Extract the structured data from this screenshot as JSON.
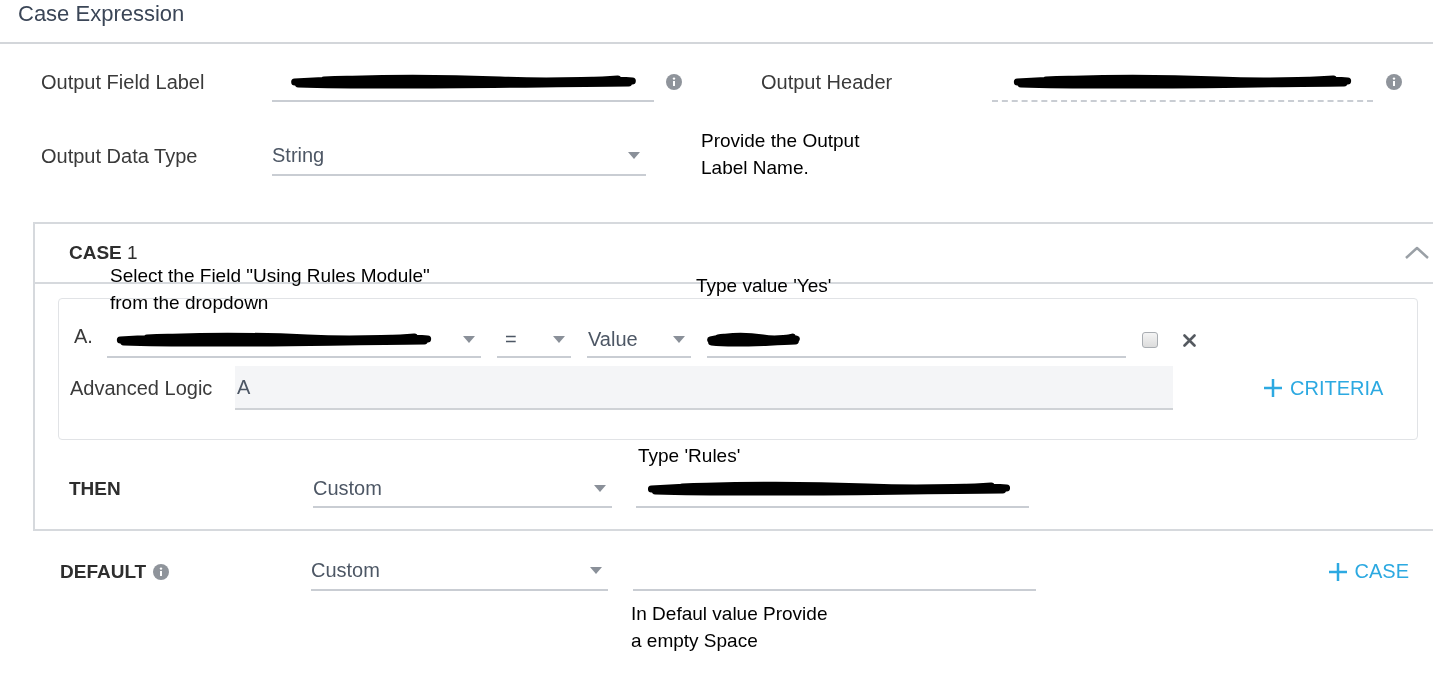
{
  "title": "Case Expression",
  "output_field_label": {
    "label": "Output Field Label",
    "redacted": true,
    "readonly": false
  },
  "output_header": {
    "label": "Output Header",
    "redacted": true,
    "readonly": true
  },
  "output_data_type": {
    "label": "Output Data Type",
    "value": "String"
  },
  "case": {
    "heading": "**CASE** 1",
    "expanded": true,
    "criteria": [
      {
        "letter": "A.",
        "field": {
          "redacted": true
        },
        "operator": "=",
        "value_type": "Value",
        "value": {
          "redacted": true
        },
        "checked": false
      }
    ],
    "advanced_logic": {
      "label": "Advanced Logic",
      "value": "A"
    },
    "add_criteria": "CRITERIA",
    "then": {
      "label": "THEN",
      "type": "Custom",
      "value": {
        "redacted": true
      }
    }
  },
  "default": {
    "label": "DEFAULT",
    "type": "Custom"
  },
  "add_case": "CASE",
  "annotations": [
    "Provide the Output\nLabel Name.",
    "Select the Field \"Using Rules Module\"\nfrom the dropdown",
    "Type value 'Yes'",
    "Type 'Rules'",
    "In Defaul value Provide\na empty Space"
  ]
}
